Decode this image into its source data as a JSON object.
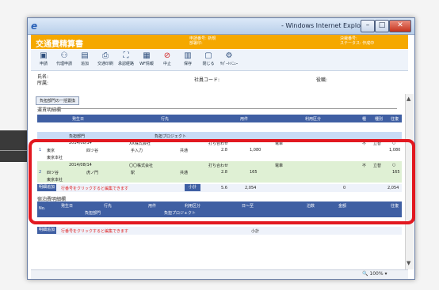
{
  "window": {
    "title": "- Windows Internet Explorer",
    "minimize": "–",
    "restore": "□",
    "close": "✕"
  },
  "app": {
    "title": "交通費精算書",
    "meta_left": [
      "申請番号: 新規",
      "部署印:"
    ],
    "meta_right": [
      "決裁番号:",
      "ステータス: 作成中"
    ]
  },
  "toolbar": [
    {
      "label": "申請",
      "icon": "▣"
    },
    {
      "label": "代理申請",
      "icon": "⚇"
    },
    {
      "label": "追加",
      "icon": "▤"
    },
    {
      "label": "交通印刷",
      "icon": "⎙"
    },
    {
      "label": "承認経路",
      "icon": "⛶"
    },
    {
      "label": "WF情報",
      "icon": "▦"
    },
    {
      "label": "中止",
      "icon": "⊘"
    },
    {
      "label": "保存",
      "icon": "▥"
    },
    {
      "label": "閉じる",
      "icon": "▢"
    },
    {
      "label": "ｻﾎﾟｰﾄﾒﾆｭｰ",
      "icon": "⚙"
    }
  ],
  "info": {
    "name_label": "氏名:",
    "dept_label": "所属:",
    "employee_code_label": "社員コード:",
    "position_label": "役職:"
  },
  "section": {
    "tab_label": "負担部門の一括置換",
    "header": "運賃明細欄"
  },
  "grid": {
    "headers": [
      "発生日",
      "行先",
      "用件",
      "利用区分",
      "種",
      "種別",
      "往復"
    ],
    "subheaders": [
      "負担部門",
      "負担プロジェクト"
    ],
    "rows": [
      {
        "num": "1",
        "date": "2014/08/14",
        "company": "XX株式会社",
        "purpose": "打ち合わせ",
        "transport": "電車",
        "kind": "不",
        "pay": "立替",
        "round": "○",
        "from": "東京",
        "to": "四ツ谷",
        "via": "手入力",
        "share": "共通",
        "units": "2.8",
        "amount": "1,080",
        "amount_right": "1,080",
        "dept": "東京本社"
      },
      {
        "num": "2",
        "date": "2014/08/14",
        "company": "〇〇株式会社",
        "purpose": "打ち合わせ",
        "transport": "電車",
        "kind": "不",
        "pay": "立替",
        "round": "○",
        "from": "四ツ谷",
        "to": "虎ノ門",
        "via": "駅",
        "share": "共通",
        "units": "2.8",
        "amount": "165",
        "amount_right": "165",
        "dept": "東京本社"
      }
    ],
    "totals": {
      "add_label": "明細追加",
      "note": "行番号をクリックすると編集できます",
      "subtotal_label": "小計",
      "units": "5.6",
      "amount": "2,054",
      "zero": "0",
      "grand": "2,054"
    }
  },
  "lower": {
    "header": "宿泊費明細欄",
    "headers": [
      "発生日",
      "行先",
      "用件",
      "利用区分",
      "日～至",
      "泊数",
      "金額",
      "往復"
    ],
    "subheaders": [
      "No.",
      "負担部門",
      "負担プロジェクト"
    ],
    "add_label": "明細追加",
    "note": "行番号をクリックすると編集できます",
    "subtotal_label": "小計"
  },
  "status": {
    "zoom": "100%"
  }
}
